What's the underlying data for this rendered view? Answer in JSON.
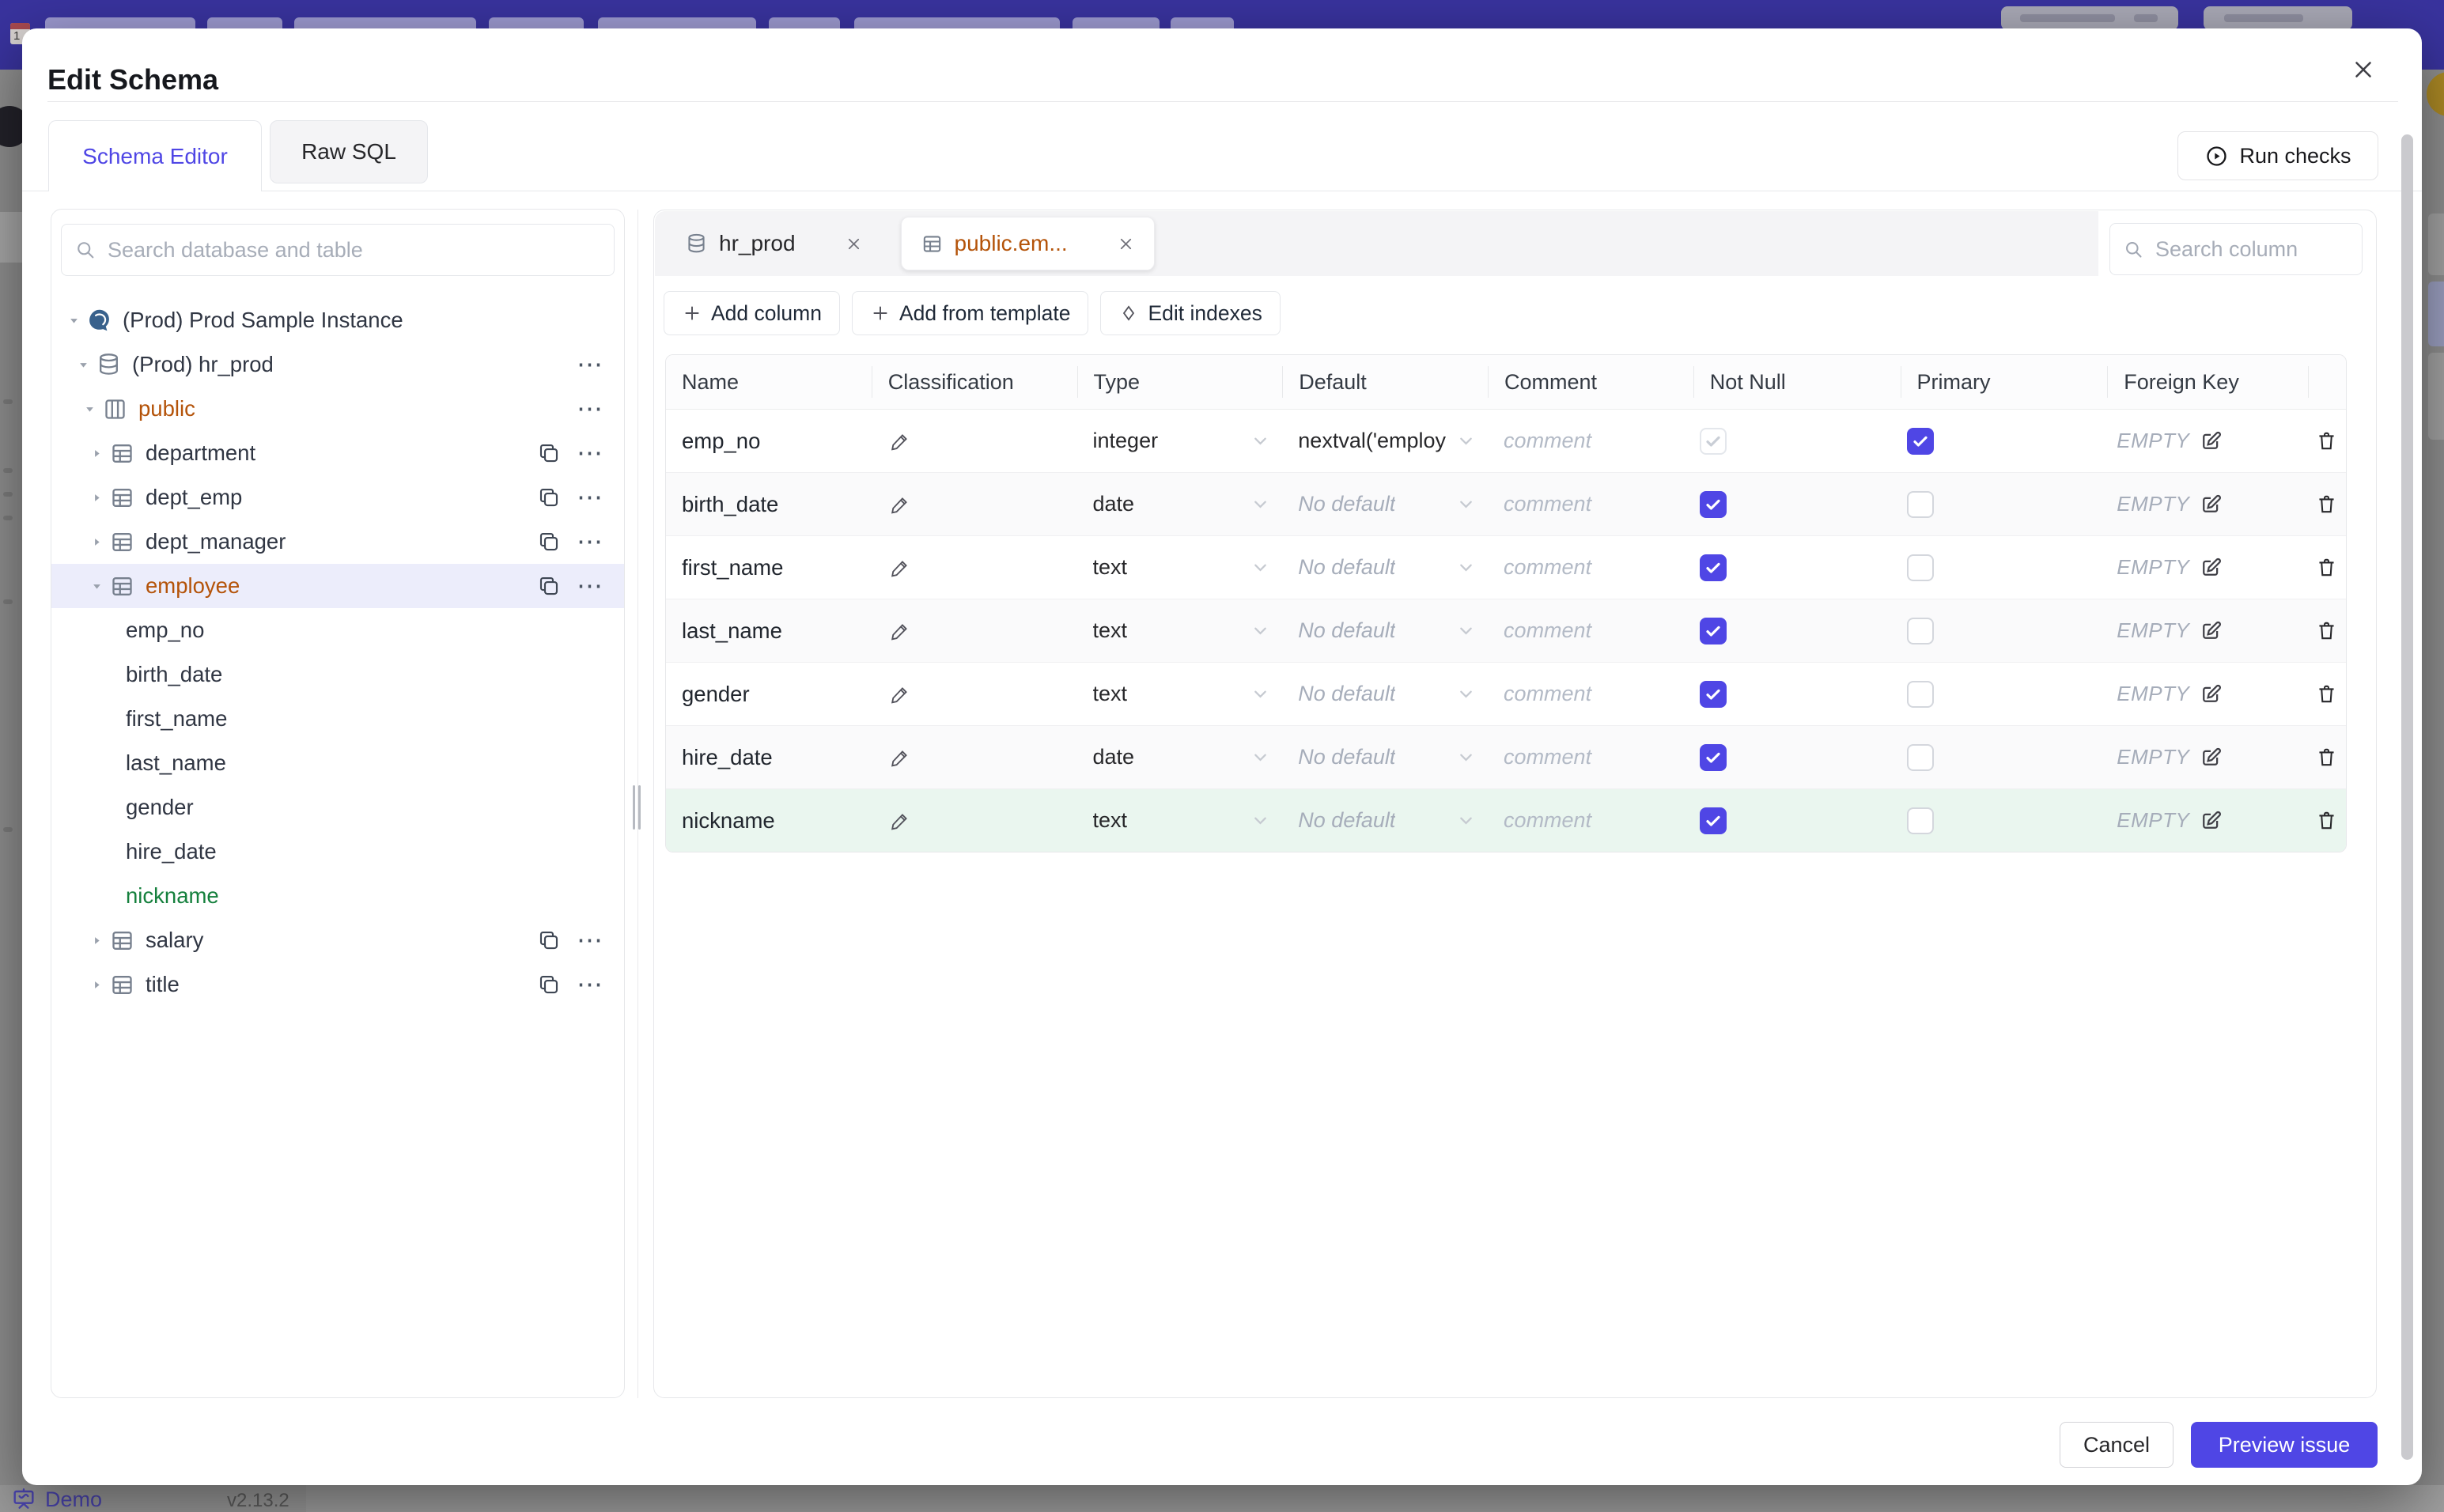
{
  "backdrop": {
    "demo_label": "Demo",
    "version_label": "v2.13.2",
    "topbar_color": "#39339e"
  },
  "modal": {
    "title": "Edit Schema",
    "tabs": [
      {
        "label": "Schema Editor",
        "active": true
      },
      {
        "label": "Raw SQL",
        "active": false
      }
    ],
    "run_checks_label": "Run checks"
  },
  "sidebar": {
    "search_placeholder": "Search database and table",
    "tree": [
      {
        "level": 0,
        "label": "(Prod) Prod Sample Instance",
        "icon": "elephant",
        "caret": "down"
      },
      {
        "level": 1,
        "label": "(Prod) hr_prod",
        "icon": "db",
        "caret": "down",
        "more": true
      },
      {
        "level": 2,
        "label": "public",
        "icon": "schema",
        "caret": "down",
        "more": true,
        "color": "amber"
      },
      {
        "level": 3,
        "label": "department",
        "icon": "table",
        "caret": "right",
        "copy": true,
        "more": true
      },
      {
        "level": 3,
        "label": "dept_emp",
        "icon": "table",
        "caret": "right",
        "copy": true,
        "more": true
      },
      {
        "level": 3,
        "label": "dept_manager",
        "icon": "table",
        "caret": "right",
        "copy": true,
        "more": true
      },
      {
        "level": 3,
        "label": "employee",
        "icon": "table",
        "caret": "down",
        "copy": true,
        "more": true,
        "color": "amber",
        "selected": true
      },
      {
        "level": 4,
        "label": "emp_no"
      },
      {
        "level": 4,
        "label": "birth_date"
      },
      {
        "level": 4,
        "label": "first_name"
      },
      {
        "level": 4,
        "label": "last_name"
      },
      {
        "level": 4,
        "label": "gender"
      },
      {
        "level": 4,
        "label": "hire_date"
      },
      {
        "level": 4,
        "label": "nickname",
        "color": "green"
      },
      {
        "level": 3,
        "label": "salary",
        "icon": "table",
        "caret": "right",
        "copy": true,
        "more": true
      },
      {
        "level": 3,
        "label": "title",
        "icon": "table",
        "caret": "right",
        "copy": true,
        "more": true
      }
    ]
  },
  "editor": {
    "tabs": [
      {
        "label": "hr_prod",
        "icon": "db",
        "active": false
      },
      {
        "label": "public.em...",
        "icon": "table",
        "active": true
      }
    ],
    "search_placeholder": "Search column",
    "toolbar": {
      "add_column": "Add column",
      "add_from_template": "Add from template",
      "edit_indexes": "Edit indexes"
    },
    "table": {
      "headers": [
        "Name",
        "Classification",
        "Type",
        "Default",
        "Comment",
        "Not Null",
        "Primary",
        "Foreign Key"
      ],
      "comment_placeholder": "comment",
      "foreign_key_empty": "EMPTY",
      "rows": [
        {
          "name": "emp_no",
          "type": "integer",
          "default": "nextval('employ",
          "default_set": true,
          "not_null": true,
          "not_null_disabled": true,
          "primary": true,
          "new": false
        },
        {
          "name": "birth_date",
          "type": "date",
          "default": "No default",
          "default_set": false,
          "not_null": true,
          "not_null_disabled": false,
          "primary": false,
          "new": false
        },
        {
          "name": "first_name",
          "type": "text",
          "default": "No default",
          "default_set": false,
          "not_null": true,
          "not_null_disabled": false,
          "primary": false,
          "new": false
        },
        {
          "name": "last_name",
          "type": "text",
          "default": "No default",
          "default_set": false,
          "not_null": true,
          "not_null_disabled": false,
          "primary": false,
          "new": false
        },
        {
          "name": "gender",
          "type": "text",
          "default": "No default",
          "default_set": false,
          "not_null": true,
          "not_null_disabled": false,
          "primary": false,
          "new": false
        },
        {
          "name": "hire_date",
          "type": "date",
          "default": "No default",
          "default_set": false,
          "not_null": true,
          "not_null_disabled": false,
          "primary": false,
          "new": false
        },
        {
          "name": "nickname",
          "type": "text",
          "default": "No default",
          "default_set": false,
          "not_null": true,
          "not_null_disabled": false,
          "primary": false,
          "new": true
        }
      ]
    }
  },
  "footer": {
    "cancel_label": "Cancel",
    "submit_label": "Preview issue"
  },
  "colors": {
    "accent": "#4f46e5",
    "modified": "#b45309",
    "created": "#15803d"
  }
}
